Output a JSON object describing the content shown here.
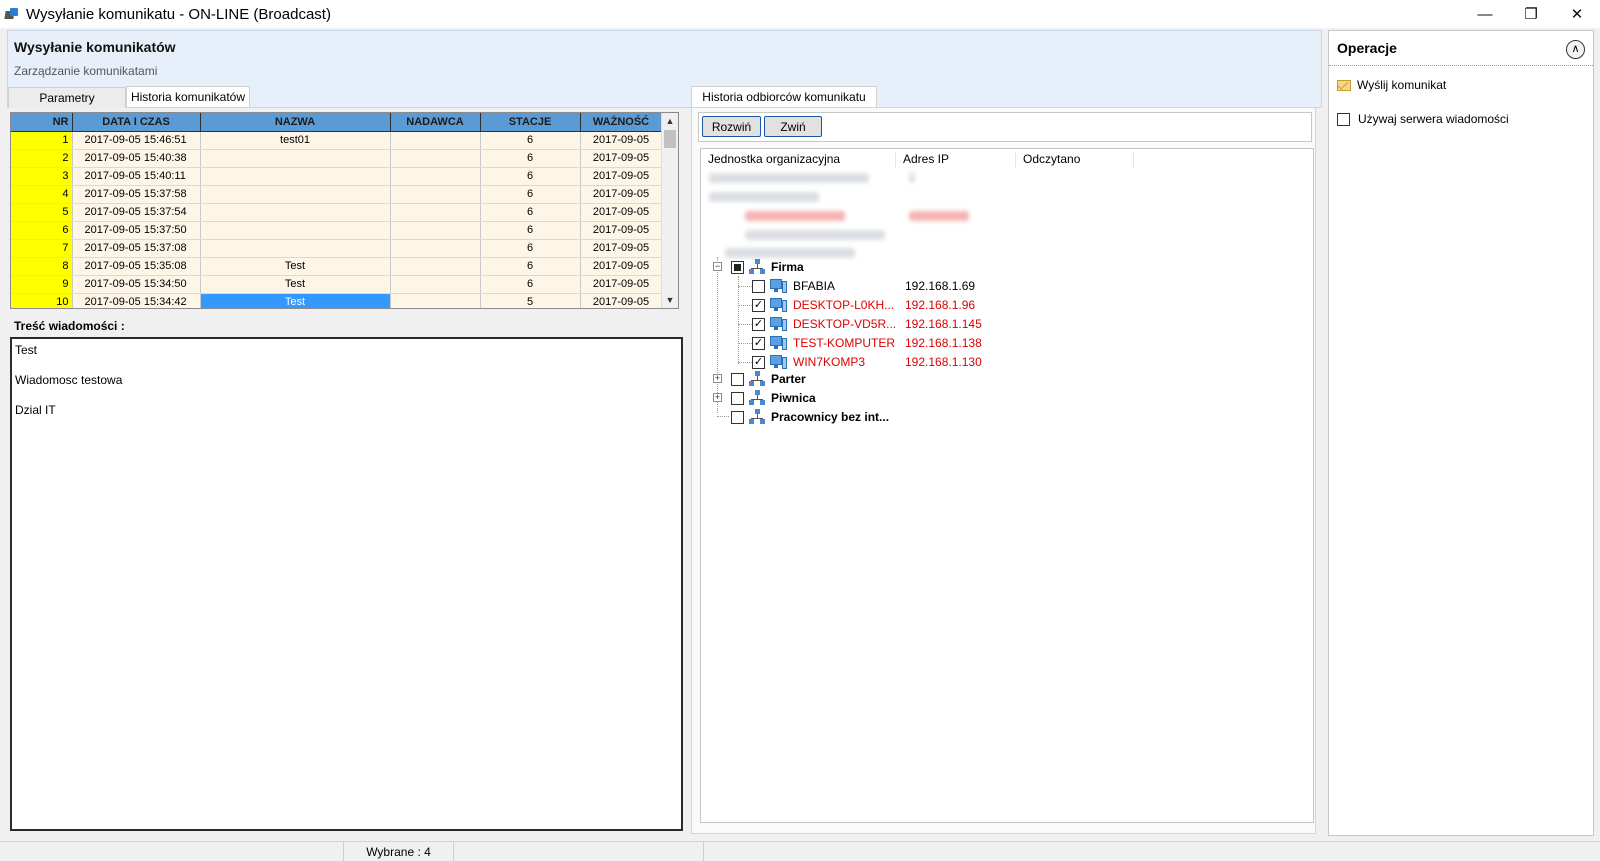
{
  "window": {
    "title": "Wysyłanie komunikatu - ON-LINE (Broadcast)",
    "minimize": "—",
    "restore": "❐",
    "close": "✕"
  },
  "header": {
    "title": "Wysyłanie komunikatów",
    "subtitle": "Zarządzanie komunikatami"
  },
  "tabs": {
    "params": "Parametry",
    "history": "Historia komunikatów",
    "recipients": "Historia odbiorców komunikatu"
  },
  "table": {
    "columns": [
      "NR",
      "DATA I CZAS",
      "NAZWA",
      "NADAWCA",
      "STACJE",
      "WAŻNOŚĆ"
    ],
    "rows": [
      [
        "1",
        "2017-09-05 15:46:51",
        "test01",
        "",
        "6",
        "2017-09-05"
      ],
      [
        "2",
        "2017-09-05 15:40:38",
        "",
        "",
        "6",
        "2017-09-05"
      ],
      [
        "3",
        "2017-09-05 15:40:11",
        "",
        "",
        "6",
        "2017-09-05"
      ],
      [
        "4",
        "2017-09-05 15:37:58",
        "",
        "",
        "6",
        "2017-09-05"
      ],
      [
        "5",
        "2017-09-05 15:37:54",
        "",
        "",
        "6",
        "2017-09-05"
      ],
      [
        "6",
        "2017-09-05 15:37:50",
        "",
        "",
        "6",
        "2017-09-05"
      ],
      [
        "7",
        "2017-09-05 15:37:08",
        "",
        "",
        "6",
        "2017-09-05"
      ],
      [
        "8",
        "2017-09-05 15:35:08",
        "Test",
        "",
        "6",
        "2017-09-05"
      ],
      [
        "9",
        "2017-09-05 15:34:50",
        "Test",
        "",
        "6",
        "2017-09-05"
      ],
      [
        "10",
        "2017-09-05 15:34:42",
        "Test",
        "",
        "5",
        "2017-09-05"
      ]
    ]
  },
  "content": {
    "label": "Treść wiadomości :",
    "lines": [
      "Test",
      "",
      "Wiadomosc testowa",
      "",
      "Dzial IT"
    ]
  },
  "recipients": {
    "expand": "Rozwiń",
    "collapse": "Zwiń",
    "columns": {
      "unit": "Jednostka organizacyjna",
      "ip": "Adres IP",
      "read": "Odczytano"
    },
    "firma": "Firma",
    "computers": [
      {
        "name": "BFABIA",
        "ip": "192.168.1.69",
        "checked": "",
        "highlight": false
      },
      {
        "name": "DESKTOP-L0KH...",
        "ip": "192.168.1.96",
        "checked": "✓",
        "highlight": true
      },
      {
        "name": "DESKTOP-VD5R...",
        "ip": "192.168.1.145",
        "checked": "✓",
        "highlight": true
      },
      {
        "name": "TEST-KOMPUTER",
        "ip": "192.168.1.138",
        "checked": "✓",
        "highlight": true
      },
      {
        "name": "WIN7KOMP3",
        "ip": "192.168.1.130",
        "checked": "✓",
        "highlight": true
      }
    ],
    "groups": [
      "Parter",
      "Piwnica",
      "Pracownicy bez int..."
    ]
  },
  "operations": {
    "title": "Operacje",
    "collapse": "∧",
    "send": "Wyślij komunikat",
    "use_server": "Używaj serwera wiadomości"
  },
  "status": {
    "selected": "Wybrane : 4"
  },
  "colors": {
    "accent": "#5b9bd5",
    "nr_highlight": "#ffff00",
    "row_bg": "#fdf5e6",
    "selection": "#3399ff",
    "sent_red": "#e00000"
  }
}
